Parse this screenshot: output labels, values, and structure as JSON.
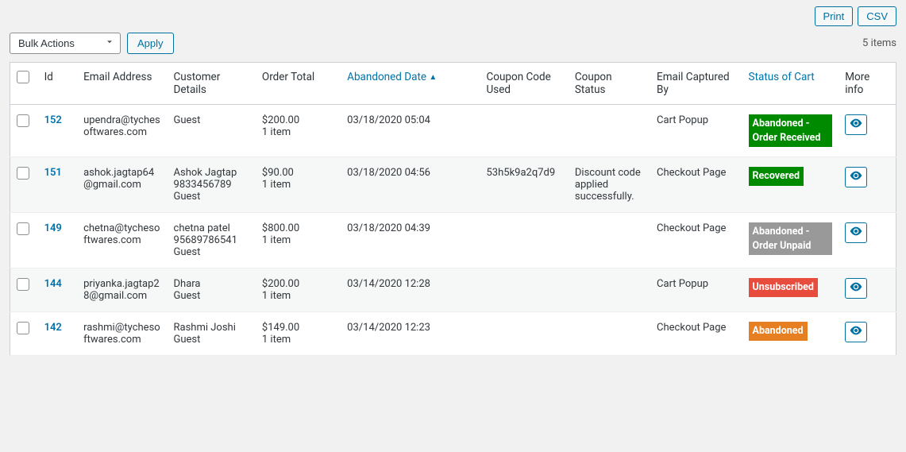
{
  "buttons": {
    "print": "Print",
    "csv": "CSV",
    "apply": "Apply"
  },
  "bulk_actions_label": "Bulk Actions",
  "items_count": "5 items",
  "headers": {
    "id": "Id",
    "email": "Email Address",
    "customer": "Customer Details",
    "order_total": "Order Total",
    "abandoned_date": "Abandoned Date",
    "coupon_used": "Coupon Code Used",
    "coupon_status": "Coupon Status",
    "email_captured": "Email Captured By",
    "cart_status": "Status of Cart",
    "more_info": "More info"
  },
  "rows": [
    {
      "id": "152",
      "email": "upendra@tychesoftwares.com",
      "customer": "Guest",
      "total_price": "$200.00",
      "total_items": "1 item",
      "date": "03/18/2020 05:04",
      "coupon": "",
      "coupon_status": "",
      "captured_by": "Cart Popup",
      "status_text": "Abandoned - Order Received",
      "status_color": "green"
    },
    {
      "id": "151",
      "email": "ashok.jagtap64@gmail.com",
      "customer": "Ashok Jagtap\n9833456789\nGuest",
      "total_price": "$90.00",
      "total_items": "1 item",
      "date": "03/18/2020 04:56",
      "coupon": "53h5k9a2q7d9",
      "coupon_status": "Discount code applied successfully.",
      "captured_by": "Checkout Page",
      "status_text": "Recovered",
      "status_color": "green"
    },
    {
      "id": "149",
      "email": "chetna@tychesoftwares.com",
      "customer": "chetna patel\n95689786541\nGuest",
      "total_price": "$800.00",
      "total_items": "1 item",
      "date": "03/18/2020 04:39",
      "coupon": "",
      "coupon_status": "",
      "captured_by": "Checkout Page",
      "status_text": "Abandoned - Order Unpaid",
      "status_color": "gray"
    },
    {
      "id": "144",
      "email": "priyanka.jagtap28@gmail.com",
      "customer": "Dhara\nGuest",
      "total_price": "$200.00",
      "total_items": "1 item",
      "date": "03/14/2020 12:28",
      "coupon": "",
      "coupon_status": "",
      "captured_by": "Cart Popup",
      "status_text": "Unsubscribed",
      "status_color": "red"
    },
    {
      "id": "142",
      "email": "rashmi@tychesoftwares.com",
      "customer": "Rashmi Joshi\nGuest",
      "total_price": "$149.00",
      "total_items": "1 item",
      "date": "03/14/2020 12:23",
      "coupon": "",
      "coupon_status": "",
      "captured_by": "Checkout Page",
      "status_text": "Abandoned",
      "status_color": "orange"
    }
  ]
}
